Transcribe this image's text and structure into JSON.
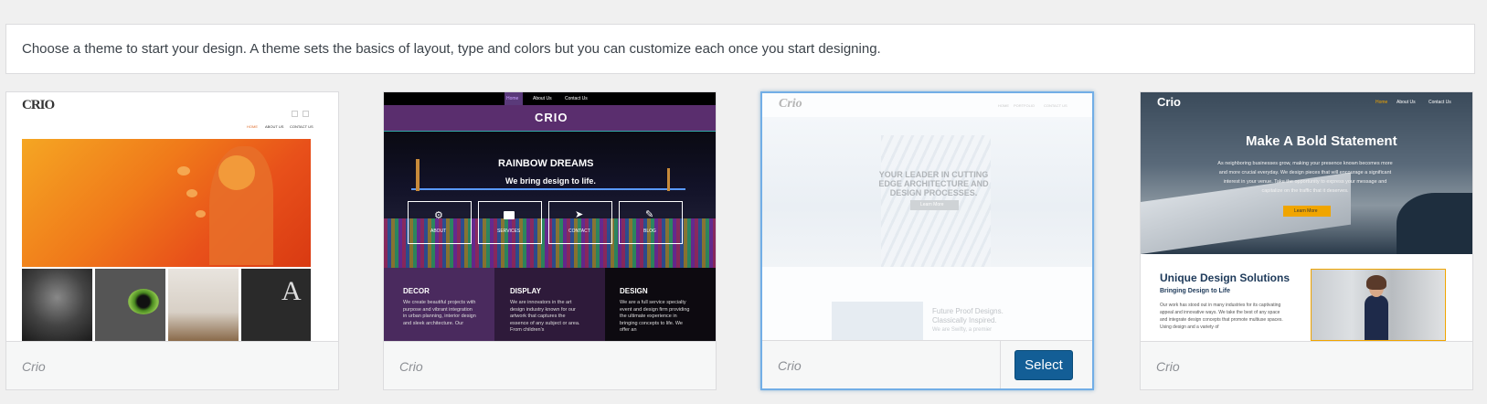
{
  "notice": "Choose a theme to start your design. A theme sets the basics of layout, type and colors but you can customize each once you start designing.",
  "themes": [
    {
      "name": "Crio",
      "preview": {
        "logo": "CRIO",
        "nav": [
          "HOME",
          "ABOUT US",
          "CONTACT US"
        ]
      }
    },
    {
      "name": "Crio",
      "preview": {
        "nav": [
          "Home",
          "About Us",
          "Contact Us"
        ],
        "logo": "CRIO",
        "hero_title": "RAINBOW DREAMS",
        "hero_sub": "We bring design to life.",
        "tiles": [
          "ABOUT",
          "SERVICES",
          "CONTACT",
          "BLOG"
        ],
        "columns": [
          {
            "title": "DECOR",
            "text": "We create beautiful projects with purpose and vibrant integration in urban planning, interior design and sleek architecture. Our"
          },
          {
            "title": "DISPLAY",
            "text": "We are innovators in the art design industry known for our artwork that captures the essence of any subject or area. From children's"
          },
          {
            "title": "DESIGN",
            "text": "We are a full service specialty event and design firm providing the ultimate experience in bringing concepts to life. We offer an"
          }
        ]
      }
    },
    {
      "name": "Crio",
      "select_label": "Select",
      "preview": {
        "logo": "Crio",
        "nav": [
          "HOME",
          "PORTFOLIO",
          "CONTACT US"
        ],
        "hero_title": "YOUR LEADER IN CUTTING EDGE ARCHITECTURE AND DESIGN PROCESSES.",
        "hero_btn": "Learn More",
        "sub_title": "Future Proof Designs. Classically Inspired.",
        "sub_text": "We are Swifty, a premier"
      }
    },
    {
      "name": "Crio",
      "preview": {
        "logo": "Crio",
        "nav": [
          "Home",
          "About Us",
          "Contact Us"
        ],
        "hero_title": "Make A Bold Statement",
        "hero_text": "As neighboring businesses grow, making your presence known becomes more and more crucial everyday. We design pieces that will encourage a significant interest in your venue. Take the opportunity to express your message and capitalize on the traffic that it deserves.",
        "hero_btn": "Learn More",
        "sec_title": "Unique Design Solutions",
        "sec_sub": "Bringing Design to Life",
        "sec_text": "Our work has stood out in many industries for its captivating appeal and innovative ways. We take the best of any space and integrate design concepts that promote multiuse spaces. Using design and a variety of"
      }
    }
  ],
  "colors": {
    "accent": "#135e96",
    "active_border": "#72aee6",
    "hero_button": "#f0a500"
  }
}
